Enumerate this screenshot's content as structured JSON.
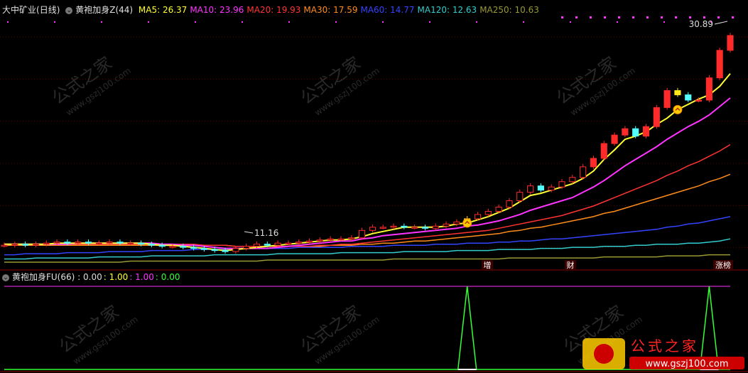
{
  "main": {
    "stock_name": "大中矿业",
    "period": "(日线)",
    "indicator": "黄袍加身Z(44)",
    "ma": [
      {
        "label": "MA5",
        "value": "26.37",
        "color": "#ffff33"
      },
      {
        "label": "MA10",
        "value": "23.96",
        "color": "#ff33ff"
      },
      {
        "label": "MA20",
        "value": "19.93",
        "color": "#ff3333"
      },
      {
        "label": "MA30",
        "value": "17.59",
        "color": "#ff8c1a"
      },
      {
        "label": "MA60",
        "value": "14.77",
        "color": "#3344ff"
      },
      {
        "label": "MA120",
        "value": "12.63",
        "color": "#33cccc"
      },
      {
        "label": "MA250",
        "value": "10.63",
        "color": "#999933"
      }
    ],
    "high_label": "30.89",
    "low_label": "11.16",
    "tags": [
      "增",
      "财",
      "涨榜"
    ]
  },
  "sub": {
    "indicator": "黄袍加身FU(66)",
    "values": [
      {
        "value": "0.00",
        "color": "#dddddd"
      },
      {
        "value": "1.00",
        "color": "#ffff33"
      },
      {
        "value": "1.00",
        "color": "#ff33ff"
      },
      {
        "value": "0.00",
        "color": "#33ff33"
      }
    ]
  },
  "watermark": {
    "text": "公式之家",
    "url": "www.gszj100.com"
  },
  "colors": {
    "up": "#ff2b2b",
    "down": "#54ffff",
    "yellow_candle": "#ffe81a"
  },
  "chart_data": [
    {
      "type": "candlestick",
      "title": "大中矿业 (日线)",
      "ylim": [
        10,
        32
      ],
      "close": [
        11.8,
        11.9,
        11.8,
        11.9,
        12.0,
        12.1,
        12.0,
        12.1,
        12.0,
        12.0,
        12.1,
        12.0,
        12.0,
        11.9,
        11.8,
        11.7,
        11.7,
        11.6,
        11.5,
        11.4,
        11.3,
        11.2,
        11.5,
        11.7,
        11.9,
        11.8,
        12.0,
        12.0,
        12.1,
        12.2,
        12.3,
        12.4,
        12.4,
        12.5,
        13.2,
        13.5,
        13.5,
        13.6,
        13.5,
        13.5,
        13.4,
        13.6,
        13.8,
        14.0,
        14.3,
        14.7,
        15.0,
        15.4,
        16.0,
        16.8,
        17.4,
        17.0,
        17.3,
        17.8,
        18.2,
        19.2,
        20.0,
        21.4,
        22.2,
        22.8,
        22.1,
        23.0,
        24.8,
        26.4,
        26.0,
        25.5,
        25.5,
        27.6,
        30.2,
        31.6
      ],
      "ma": {
        "MA5": [
          11.9,
          11.9,
          11.9,
          11.9,
          11.9,
          12.0,
          12.0,
          12.0,
          12.0,
          12.0,
          12.0,
          12.0,
          12.0,
          12.0,
          11.9,
          11.8,
          11.8,
          11.7,
          11.6,
          11.5,
          11.4,
          11.3,
          11.4,
          11.5,
          11.6,
          11.7,
          11.8,
          11.9,
          12.0,
          12.1,
          12.2,
          12.3,
          12.3,
          12.4,
          12.6,
          12.9,
          13.1,
          13.3,
          13.5,
          13.5,
          13.5,
          13.5,
          13.6,
          13.8,
          13.9,
          14.2,
          14.5,
          14.9,
          15.3,
          15.9,
          16.5,
          16.7,
          17.0,
          17.3,
          17.6,
          18.1,
          18.8,
          19.9,
          20.8,
          21.8,
          22.1,
          22.5,
          23.2,
          23.8,
          24.6,
          25.1,
          25.6,
          26.0,
          26.8,
          28.0
        ],
        "MA10": [
          11.9,
          11.9,
          11.9,
          11.9,
          11.9,
          11.9,
          11.9,
          12.0,
          12.0,
          12.0,
          12.0,
          12.0,
          12.0,
          12.0,
          12.0,
          11.9,
          11.9,
          11.8,
          11.8,
          11.7,
          11.6,
          11.5,
          11.5,
          11.5,
          11.5,
          11.5,
          11.6,
          11.7,
          11.8,
          11.9,
          12.0,
          12.1,
          12.2,
          12.2,
          12.4,
          12.5,
          12.7,
          12.8,
          12.9,
          13.0,
          13.1,
          13.2,
          13.3,
          13.4,
          13.6,
          13.7,
          13.9,
          14.1,
          14.4,
          14.7,
          15.1,
          15.4,
          15.7,
          16.0,
          16.3,
          16.8,
          17.3,
          17.9,
          18.6,
          19.3,
          19.9,
          20.5,
          21.1,
          21.8,
          22.4,
          23.0,
          23.5,
          24.1,
          24.9,
          25.7
        ],
        "MA20": [
          11.9,
          11.9,
          11.9,
          11.9,
          11.9,
          11.9,
          11.9,
          11.9,
          11.9,
          11.9,
          11.9,
          11.9,
          11.9,
          11.9,
          11.9,
          11.9,
          11.9,
          11.9,
          11.9,
          11.8,
          11.8,
          11.8,
          11.7,
          11.7,
          11.7,
          11.7,
          11.7,
          11.7,
          11.7,
          11.7,
          11.8,
          11.8,
          11.9,
          11.9,
          12.0,
          12.1,
          12.2,
          12.3,
          12.4,
          12.5,
          12.6,
          12.7,
          12.8,
          12.9,
          13.0,
          13.1,
          13.2,
          13.4,
          13.6,
          13.8,
          14.0,
          14.2,
          14.4,
          14.6,
          14.9,
          15.2,
          15.5,
          15.9,
          16.3,
          16.7,
          17.1,
          17.5,
          17.9,
          18.4,
          18.8,
          19.3,
          19.7,
          20.2,
          20.7,
          21.3
        ],
        "MA30": [
          11.8,
          11.8,
          11.8,
          11.8,
          11.8,
          11.8,
          11.8,
          11.8,
          11.8,
          11.8,
          11.8,
          11.8,
          11.8,
          11.8,
          11.8,
          11.8,
          11.8,
          11.8,
          11.8,
          11.8,
          11.8,
          11.8,
          11.7,
          11.7,
          11.7,
          11.7,
          11.7,
          11.7,
          11.7,
          11.7,
          11.7,
          11.8,
          11.8,
          11.8,
          11.9,
          11.9,
          12.0,
          12.0,
          12.1,
          12.2,
          12.2,
          12.3,
          12.4,
          12.5,
          12.6,
          12.7,
          12.8,
          12.9,
          13.1,
          13.2,
          13.4,
          13.5,
          13.7,
          13.9,
          14.1,
          14.3,
          14.5,
          14.8,
          15.0,
          15.3,
          15.6,
          15.9,
          16.2,
          16.5,
          16.8,
          17.1,
          17.4,
          17.8,
          18.1,
          18.5
        ],
        "MA60": [
          10.9,
          10.9,
          11.0,
          11.0,
          11.0,
          11.0,
          11.1,
          11.1,
          11.1,
          11.1,
          11.2,
          11.2,
          11.2,
          11.2,
          11.3,
          11.3,
          11.3,
          11.3,
          11.4,
          11.4,
          11.4,
          11.4,
          11.4,
          11.5,
          11.5,
          11.5,
          11.5,
          11.5,
          11.6,
          11.6,
          11.6,
          11.6,
          11.6,
          11.7,
          11.7,
          11.7,
          11.7,
          11.8,
          11.8,
          11.8,
          11.8,
          11.9,
          11.9,
          11.9,
          12.0,
          12.0,
          12.0,
          12.1,
          12.1,
          12.2,
          12.2,
          12.3,
          12.4,
          12.4,
          12.5,
          12.6,
          12.7,
          12.8,
          12.9,
          13.0,
          13.1,
          13.2,
          13.3,
          13.5,
          13.6,
          13.8,
          13.9,
          14.1,
          14.3,
          14.5
        ],
        "MA120": [
          10.5,
          10.5,
          10.5,
          10.6,
          10.6,
          10.6,
          10.6,
          10.6,
          10.6,
          10.7,
          10.7,
          10.7,
          10.7,
          10.7,
          10.8,
          10.8,
          10.8,
          10.8,
          10.8,
          10.8,
          10.9,
          10.9,
          10.9,
          10.9,
          10.9,
          10.9,
          11.0,
          11.0,
          11.0,
          11.0,
          11.0,
          11.0,
          11.1,
          11.1,
          11.1,
          11.1,
          11.1,
          11.1,
          11.2,
          11.2,
          11.2,
          11.2,
          11.2,
          11.3,
          11.3,
          11.3,
          11.3,
          11.4,
          11.4,
          11.4,
          11.4,
          11.5,
          11.5,
          11.5,
          11.6,
          11.6,
          11.6,
          11.7,
          11.7,
          11.7,
          11.8,
          11.8,
          11.9,
          11.9,
          11.9,
          12.0,
          12.0,
          12.1,
          12.2,
          12.4
        ],
        "MA250": [
          10.2,
          10.2,
          10.2,
          10.2,
          10.2,
          10.2,
          10.2,
          10.2,
          10.2,
          10.2,
          10.2,
          10.2,
          10.3,
          10.3,
          10.3,
          10.3,
          10.3,
          10.3,
          10.3,
          10.3,
          10.3,
          10.3,
          10.3,
          10.3,
          10.3,
          10.4,
          10.4,
          10.4,
          10.4,
          10.4,
          10.4,
          10.4,
          10.4,
          10.4,
          10.4,
          10.4,
          10.4,
          10.5,
          10.5,
          10.5,
          10.5,
          10.5,
          10.5,
          10.5,
          10.5,
          10.5,
          10.5,
          10.5,
          10.6,
          10.6,
          10.6,
          10.6,
          10.6,
          10.6,
          10.6,
          10.6,
          10.6,
          10.7,
          10.7,
          10.7,
          10.7,
          10.7,
          10.7,
          10.8,
          10.8,
          10.8,
          10.8,
          10.9,
          10.9,
          10.9
        ]
      }
    },
    {
      "type": "line",
      "title": "黄袍加身FU(66)",
      "ylim": [
        0,
        1
      ],
      "signal_peaks": [
        44,
        67
      ]
    }
  ]
}
